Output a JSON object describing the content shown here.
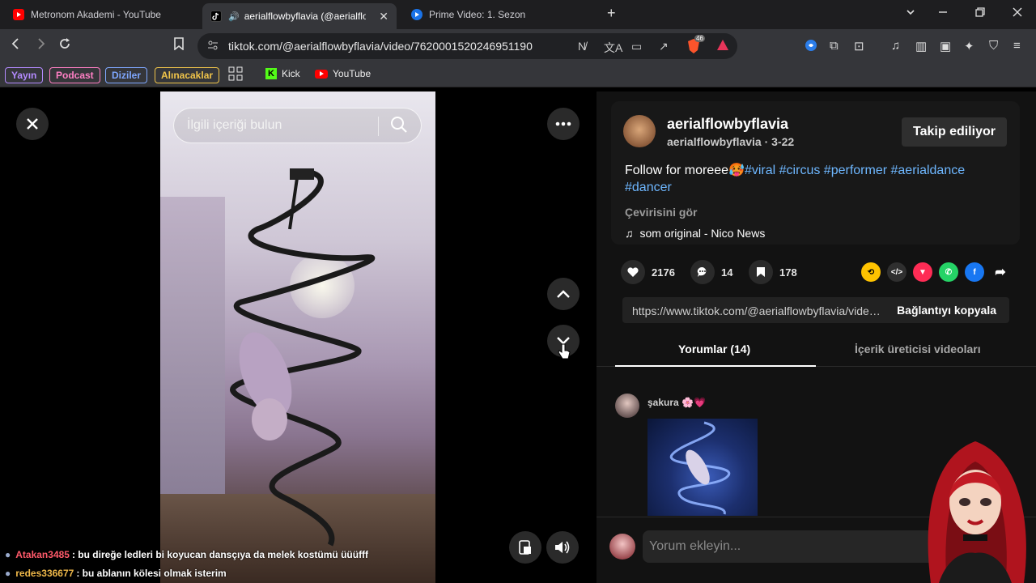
{
  "browser": {
    "tabs": [
      {
        "title": "Metronom Akademi - YouTube",
        "icon": "youtube-icon",
        "active": false
      },
      {
        "title": "aerialflowbyflavia (@aerialflo",
        "icon": "tiktok-icon",
        "active": true
      },
      {
        "title": "Prime Video: 1. Sezon",
        "icon": "prime-video-icon",
        "active": false
      }
    ],
    "new_tab": "+",
    "url": "tiktok.com/@aerialflowbyflavia/video/7620001520246951190",
    "brave_badge": "46",
    "bookmarks": [
      {
        "label": "Yayın",
        "color": "#b48bff"
      },
      {
        "label": "Podcast",
        "color": "#ff7fc4"
      },
      {
        "label": "Diziler",
        "color": "#7fa8ff"
      },
      {
        "label": "Alınacaklar",
        "color": "#f0c44a"
      }
    ],
    "bookmark_links": [
      "Kick",
      "YouTube"
    ]
  },
  "video": {
    "search_placeholder": "İlgili içeriği bulun"
  },
  "chat": [
    {
      "user": "Atakan3485",
      "user_color": "#ff5a6a",
      "text": ": bu direğe ledleri bi koyucan dansçıya da melek kostümü üüüfff"
    },
    {
      "user": "redes336677",
      "user_color": "#f0b94a",
      "text": ": bu ablanın kölesi olmak isterim"
    }
  ],
  "post": {
    "author_name": "aerialflowbyflavia",
    "author_handle": "aerialflowbyflavia",
    "date": "3-22",
    "follow_label": "Takip ediliyor",
    "caption_text": "Follow for moreee",
    "caption_emoji": "🥵",
    "hashtags": [
      "#viral",
      "#circus",
      "#performer",
      "#aerialdance",
      "#dancer"
    ],
    "translate_label": "Çevirisini gör",
    "sound": "som original - Nico News",
    "likes": "2176",
    "comments": "14",
    "saves": "178",
    "link": "https://www.tiktok.com/@aerialflowbyflavia/video/7620001520246951190",
    "copy_label": "Bağlantıyı kopyala"
  },
  "tabs": {
    "comments": "Yorumlar (14)",
    "creator_videos": "İçerik üreticisi videoları"
  },
  "comment": {
    "name": "şakura 🌸💗"
  },
  "add_comment_placeholder": "Yorum ekleyin...",
  "colors": {
    "hashtag": "#6eb7ff",
    "background": "#121212"
  }
}
